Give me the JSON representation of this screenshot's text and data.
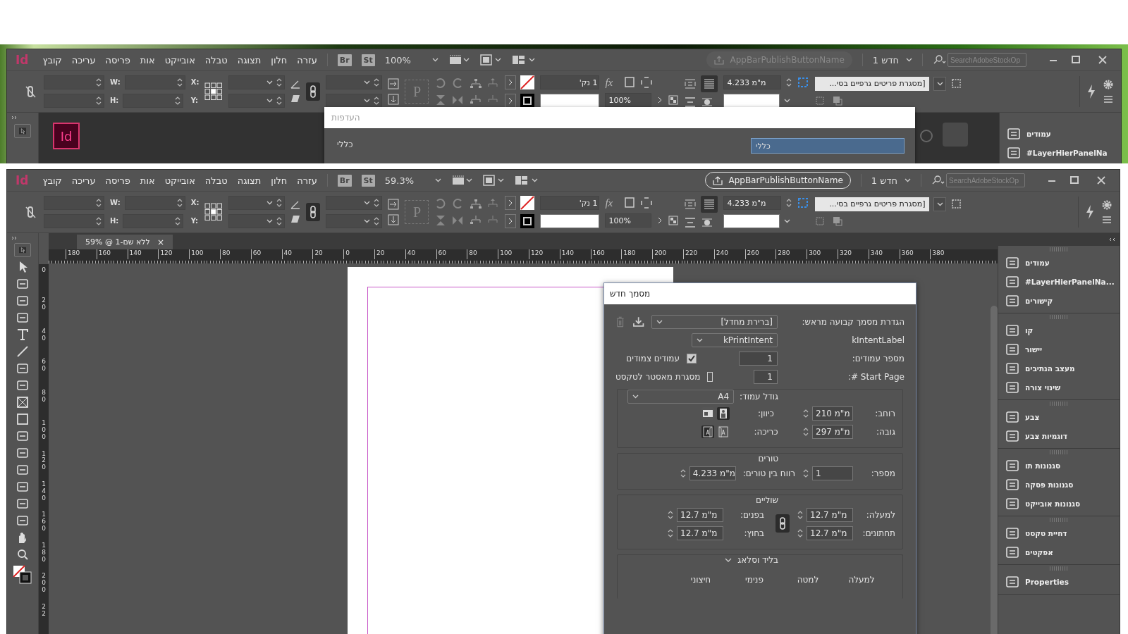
{
  "background_window": {
    "app_logo": "Id",
    "menu": [
      "עזרה",
      "חלון",
      "תצוגה",
      "טבלה",
      "אובייקט",
      "אות",
      "פריסה",
      "עריכה",
      "קובץ"
    ],
    "bridge": "Br",
    "stock": "St",
    "zoom": "100%",
    "publish_button": {
      "label": "AppBarPublishButtonName",
      "disabled": true
    },
    "document_menu": "חדש 1",
    "search": {
      "placeholder": "SearchAdobeStockOp"
    },
    "control": {
      "w_label": "W:",
      "h_label": "H:",
      "x_label": "X:",
      "y_label": "Y:",
      "paragraph_glyph": "P",
      "effects_glyph": "fx",
      "stroke_weight": "1 נק'",
      "opacity": "100%",
      "gap": "4.233 מ\"מ",
      "object_style": "[מסגרת פריטים גרפיים בסי..."
    },
    "home_logo": "Id",
    "preferences_dialog": {
      "title": "העדפות",
      "section_title": "כללי",
      "list_items": [
        {
          "label": "כללי",
          "selected": true
        }
      ]
    },
    "panel_items": [
      "עמודים",
      "#LayerHierPanelNa"
    ]
  },
  "main_window": {
    "app_logo": "Id",
    "menu": [
      "עזרה",
      "חלון",
      "תצוגה",
      "טבלה",
      "אובייקט",
      "אות",
      "פריסה",
      "עריכה",
      "קובץ"
    ],
    "bridge": "Br",
    "stock": "St",
    "zoom": "59.3%",
    "publish_button": {
      "label": "AppBarPublishButtonName",
      "disabled": false
    },
    "document_menu": "חדש 1",
    "search": {
      "placeholder": "SearchAdobeStockOp"
    },
    "control": {
      "w_label": "W:",
      "h_label": "H:",
      "x_label": "X:",
      "y_label": "Y:",
      "paragraph_glyph": "P",
      "effects_glyph": "fx",
      "stroke_weight": "1 נק'",
      "opacity": "100%",
      "gap": "4.233 מ\"מ",
      "object_style": "[מסגרת פריטים גרפיים בסי..."
    },
    "document_tab": {
      "label": "ללא שם-1 @ 59%",
      "close": "×",
      "selected": true
    },
    "horizontal_ruler": [
      "380",
      "360",
      "340",
      "320",
      "300",
      "280",
      "260",
      "240",
      "220",
      "200",
      "180",
      "160",
      "140",
      "120",
      "100",
      "80",
      "60",
      "40",
      "20",
      "0",
      "20",
      "40",
      "60",
      "80",
      "100",
      "120",
      "140",
      "160",
      "180"
    ],
    "vertical_ruler": [
      "0",
      "20",
      "40",
      "60",
      "80",
      "100",
      "120",
      "140",
      "160",
      "180",
      "200",
      "22"
    ],
    "panel_groups": [
      [
        "עמודים",
        "#LayerHierPanelNa...",
        "קישורים"
      ],
      [
        "קו",
        "יישור",
        "מעצב הנתיבים",
        "שינוי צורה"
      ],
      [
        "צבע",
        "דוגמיות צבע"
      ],
      [
        "סגנונות תו",
        "סגנונות פסקה",
        "סגנונות אובייקט"
      ],
      [
        "דחיית טקסט",
        "אפקטים"
      ],
      [
        "Properties"
      ]
    ]
  },
  "new_document_dialog": {
    "title": "מסמך חדש",
    "preset": {
      "label": "הגדרת מסמך קבועה מראש:",
      "value": "[ברירת מחדל]"
    },
    "intent": {
      "label": "kIntentLabel",
      "value": "kPrintIntent"
    },
    "pages": {
      "label": "מספר עמודים:",
      "value": "1"
    },
    "facing_pages": {
      "label": "עמודים צמודים",
      "checked": true
    },
    "start_page": {
      "label": "Start Page #:",
      "value": "1"
    },
    "master_text_frame": {
      "label": "מסגרת מאסטר לטקסט",
      "checked": false
    },
    "page_size": {
      "label": "גודל עמוד:",
      "value": "A4"
    },
    "width": {
      "label": "רוחב:",
      "value": "210 מ\"מ"
    },
    "height": {
      "label": "גובה:",
      "value": "297 מ\"מ"
    },
    "orientation": {
      "label": "כיוון:",
      "options": [
        {
          "kind": "portrait",
          "selected": true
        },
        {
          "kind": "landscape",
          "selected": false
        }
      ]
    },
    "binding": {
      "label": "כריכה:",
      "options": [
        {
          "kind": "left-to-right",
          "selected": false
        },
        {
          "kind": "right-to-left",
          "selected": true
        }
      ]
    },
    "columns": {
      "title": "טורים",
      "number_label": "מספר:",
      "number": "1",
      "gutter_label": "רווח בין טורים:",
      "gutter": "4.233 מ\"מ"
    },
    "margins": {
      "title": "שוליים",
      "top_label": "למעלה:",
      "top": "12.7 מ\"מ",
      "bottom_label": "תחתונים:",
      "bottom": "12.7 מ\"מ",
      "inside_label": "בפנים:",
      "inside": "12.7 מ\"מ",
      "outside_label": "בחוץ:",
      "outside": "12.7 מ\"מ"
    },
    "bleed_slug": {
      "title": "בליד וסלאג",
      "expanded": true,
      "headers": [
        "למעלה",
        "למטה",
        "פנימי",
        "חיצוני"
      ]
    }
  }
}
